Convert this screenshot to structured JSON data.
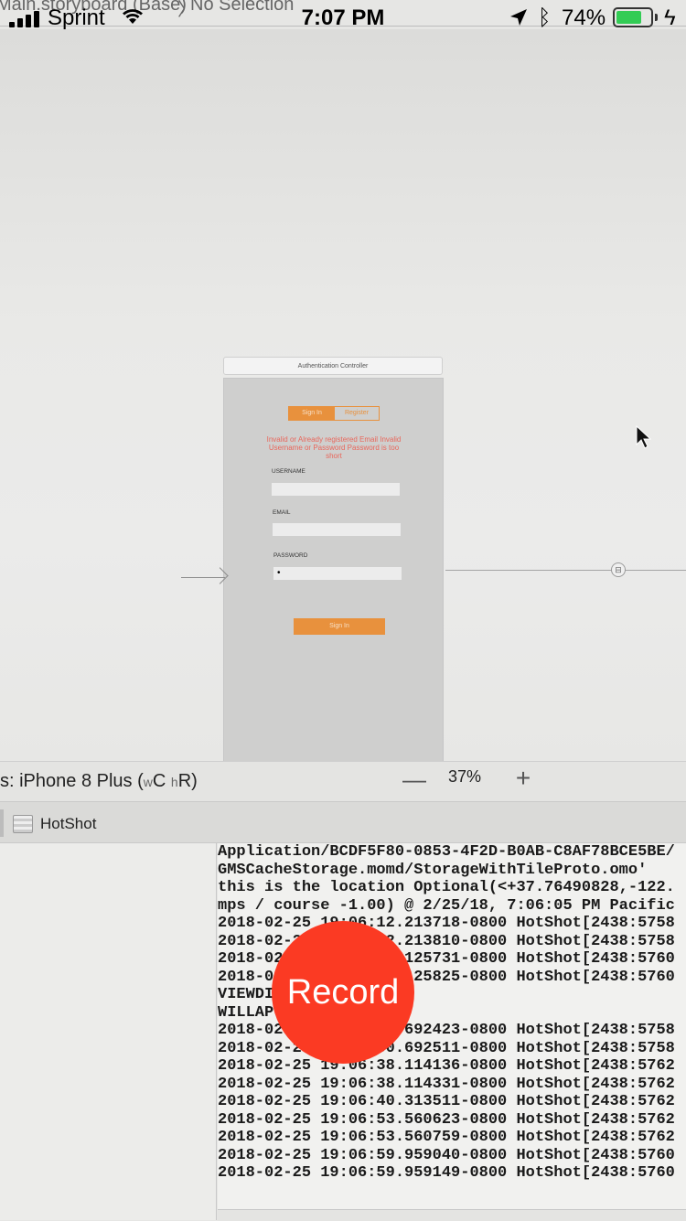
{
  "status_bar": {
    "carrier": "Sprint",
    "time": "7:07 PM",
    "battery_percent": "74%",
    "battery_level": 0.74,
    "icons": [
      "cellular-signal-icon",
      "wifi-icon",
      "location-arrow-icon",
      "bluetooth-icon",
      "battery-icon",
      "charging-icon"
    ]
  },
  "jumpbar": {
    "storyboard": "Main.storyboard (Base)",
    "separator": "〉",
    "selection": "No Selection"
  },
  "scene": {
    "title": "Authentication Controller",
    "segments": [
      "Sign In",
      "Register"
    ],
    "error_text": "Invalid or Already registered Email Invalid Username or Password Password is too short",
    "fields": [
      {
        "label": "USERNAME",
        "value": ""
      },
      {
        "label": "EMAIL",
        "value": ""
      },
      {
        "label": "PASSWORD",
        "value": "•"
      }
    ],
    "submit_label": "Sign In",
    "accent": "#e8913d",
    "error_color": "#e8675c"
  },
  "canvas_bar": {
    "device": "s: iPhone 8 Plus (",
    "size_class_w": "w",
    "size_class_w_value": "C",
    "size_class_h": "h",
    "size_class_h_value": "R)",
    "zoom_out": "—",
    "zoom_level": "37%",
    "zoom_in": "+"
  },
  "debug": {
    "scheme_name": "HotShot"
  },
  "console": {
    "lines": [
      "Application/BCDF5F80-0853-4F2D-B0AB-C8AF78BCE5BE/",
      "GMSCacheStorage.momd/StorageWithTileProto.omo'",
      "this is the location Optional(<+37.76490828,-122.",
      "mps / course -1.00) @ 2/25/18, 7:06:05 PM Pacific",
      "2018-02-25 19:06:12.213718-0800 HotShot[2438:5758",
      "2018-02-25 19:06:12.213810-0800 HotShot[2438:5758",
      "2018-02-25 19:06:25.125731-0800 HotShot[2438:5760",
      "2018-02-25 19:06:25.125825-0800 HotShot[2438:5760",
      "VIEWDID",
      "WILLAP",
      "2018-02-25 19:06:30.692423-0800 HotShot[2438:5758",
      "2018-02-25 19:06:30.692511-0800 HotShot[2438:5758",
      "2018-02-25 19:06:38.114136-0800 HotShot[2438:5762",
      "2018-02-25 19:06:38.114331-0800 HotShot[2438:5762",
      "2018-02-25 19:06:40.313511-0800 HotShot[2438:5762",
      "2018-02-25 19:06:53.560623-0800 HotShot[2438:5762",
      "2018-02-25 19:06:53.560759-0800 HotShot[2438:5762",
      "2018-02-25 19:06:59.959040-0800 HotShot[2438:5760",
      "2018-02-25 19:06:59.959149-0800 HotShot[2438:5760"
    ]
  },
  "record": {
    "label": "Record",
    "color": "#fb3a23"
  }
}
